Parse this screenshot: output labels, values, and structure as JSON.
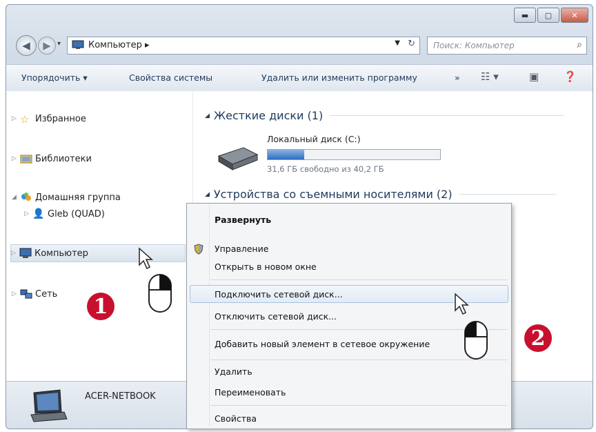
{
  "window": {
    "caption_buttons": [
      "minimize",
      "maximize",
      "close"
    ]
  },
  "address": {
    "breadcrumb": "Компьютер ▸",
    "search_placeholder": "Поиск: Компьютер"
  },
  "toolbar": {
    "organize": "Упорядочить ▾",
    "system_properties": "Свойства системы",
    "uninstall": "Удалить или изменить программу",
    "more": "»"
  },
  "nav": {
    "favorites": "Избранное",
    "libraries": "Библиотеки",
    "homegroup": "Домашняя группа",
    "user": "Gleb (QUAD)",
    "computer": "Компьютер",
    "network": "Сеть"
  },
  "content": {
    "hdd_group": "Жесткие диски (1)",
    "drive_name": "Локальный диск (C:)",
    "drive_free": "31,6 ГБ свободно из 40,2 ГБ",
    "drive_used_fraction": 0.21,
    "removable_group": "Устройства со съемными носителями (2)"
  },
  "details": {
    "computer_name": "ACER-NETBOOK"
  },
  "context_menu": {
    "items": [
      "Развернуть",
      "Управление",
      "Открыть в новом окне",
      "Подключить сетевой диск...",
      "Отключить сетевой диск...",
      "Добавить новый элемент в сетевое окружение",
      "Удалить",
      "Переименовать",
      "Свойства"
    ]
  },
  "markers": [
    "1",
    "2"
  ],
  "colors": {
    "marker": "#c8102e",
    "accent": "#1e395b"
  }
}
